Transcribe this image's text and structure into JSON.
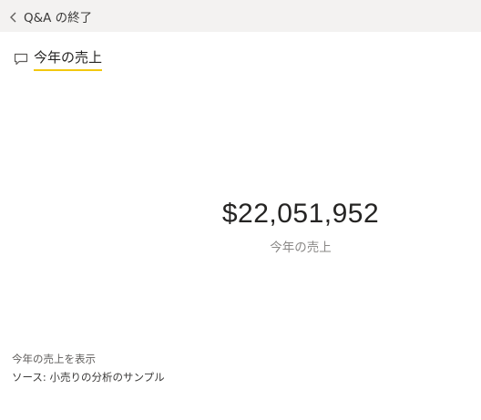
{
  "topbar": {
    "back_label": "Q&A の終了"
  },
  "question": {
    "text": "今年の売上",
    "underline_color": "#f2c80f"
  },
  "kpi": {
    "value": "$22,051,952",
    "label": "今年の売上"
  },
  "footer": {
    "show_text": "今年の売上を表示",
    "source_text": "ソース: 小売りの分析のサンプル"
  },
  "icons": {
    "back": "chevron-left-icon",
    "question": "chat-bubble-icon"
  }
}
